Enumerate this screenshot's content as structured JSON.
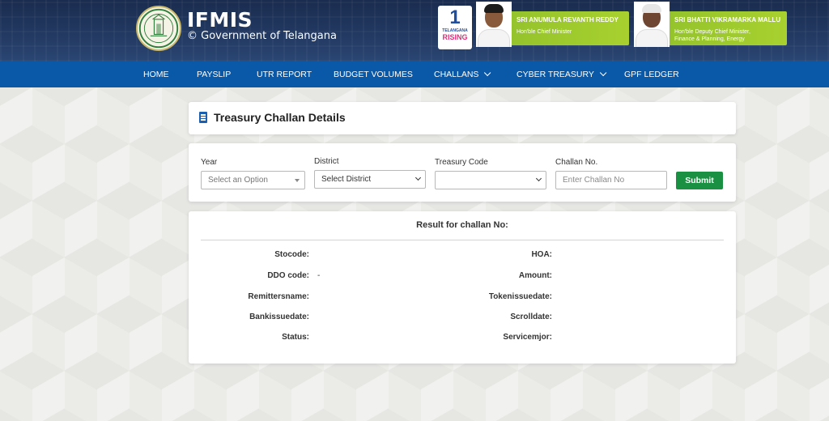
{
  "header": {
    "title": "IFMIS",
    "subtitle": "© Government of Telangana",
    "rising_badge": {
      "number": "1",
      "line1": "TELANGANA",
      "line2": "RISING"
    },
    "leaders": [
      {
        "name": "SRI ANUMULA REVANTH REDDY",
        "role_lines": [
          "Hon'ble Chief Minister"
        ]
      },
      {
        "name": "SRI BHATTI VIKRAMARKA MALLU",
        "role_lines": [
          "Hon'ble Deputy Chief Minister,",
          "Finance & Planning, Energy"
        ]
      }
    ],
    "colors": {
      "header_bg": "#233a63",
      "nav_bg": "#0a58a8",
      "leader_banner": "#a8d12f",
      "submit": "#1a9142"
    }
  },
  "nav": {
    "items": [
      {
        "label": "HOME",
        "dropdown": false
      },
      {
        "label": "PAYSLIP",
        "dropdown": false
      },
      {
        "label": "UTR REPORT",
        "dropdown": false
      },
      {
        "label": "BUDGET VOLUMES",
        "dropdown": false
      },
      {
        "label": "CHALLANS",
        "dropdown": true
      },
      {
        "label": "CYBER TREASURY",
        "dropdown": true
      },
      {
        "label": "GPF LEDGER",
        "dropdown": false
      }
    ]
  },
  "page": {
    "title": "Treasury Challan Details"
  },
  "form": {
    "year": {
      "label": "Year",
      "value": "Select an Option"
    },
    "district": {
      "label": "District",
      "value": "Select District"
    },
    "treasury": {
      "label": "Treasury Code",
      "value": ""
    },
    "challan": {
      "label": "Challan No.",
      "placeholder": "Enter Challan No"
    },
    "submit_label": "Submit"
  },
  "result": {
    "title": "Result for challan No:",
    "left": [
      {
        "label": "Stocode:",
        "value": ""
      },
      {
        "label": "DDO code:",
        "value": "-"
      },
      {
        "label": "Remittersname:",
        "value": ""
      },
      {
        "label": "Bankissuedate:",
        "value": ""
      },
      {
        "label": "Status:",
        "value": ""
      }
    ],
    "right": [
      {
        "label": "HOA:",
        "value": ""
      },
      {
        "label": "Amount:",
        "value": ""
      },
      {
        "label": "Tokenissuedate:",
        "value": ""
      },
      {
        "label": "Scrolldate:",
        "value": ""
      },
      {
        "label": "Servicemjor:",
        "value": ""
      }
    ]
  }
}
